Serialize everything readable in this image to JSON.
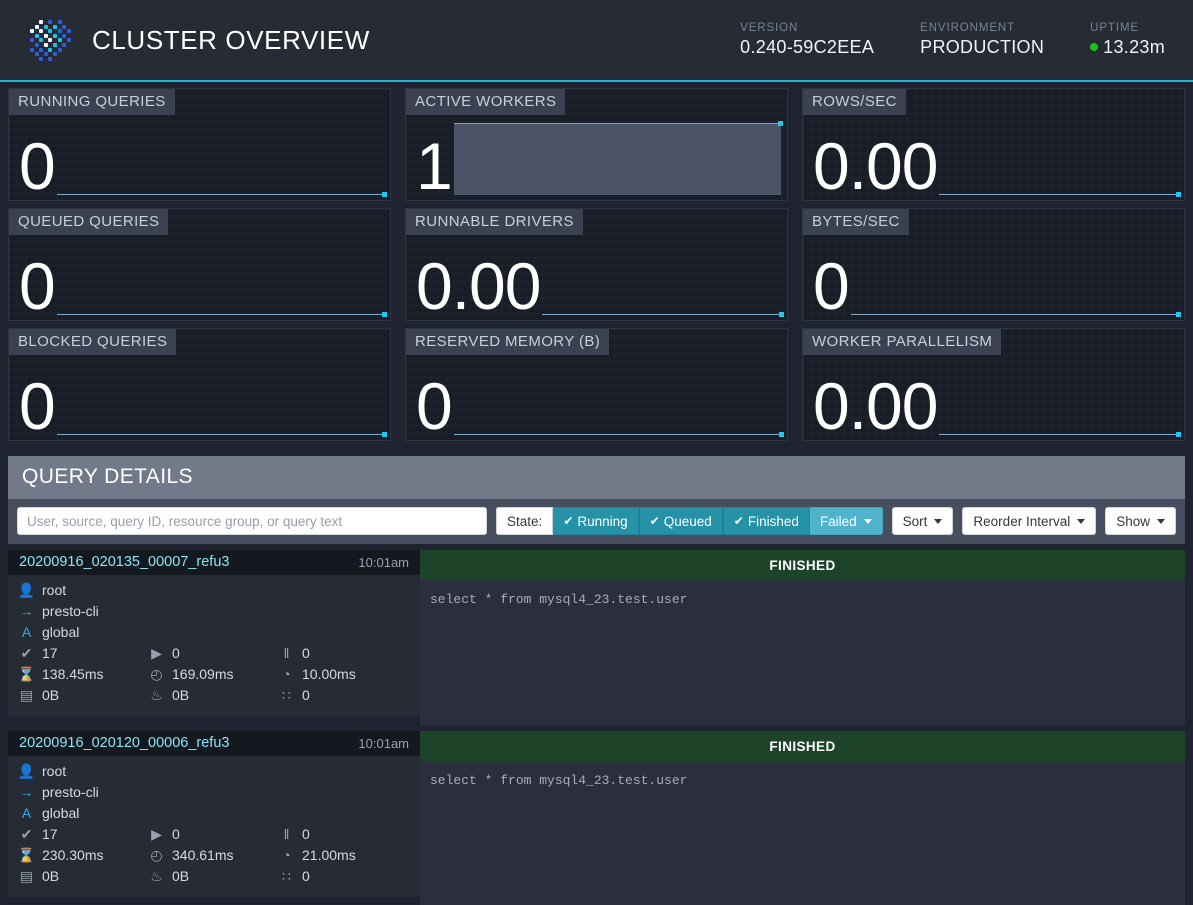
{
  "header": {
    "title": "CLUSTER OVERVIEW",
    "logo_icon": "presto-logo-icon",
    "stats": [
      {
        "key": "VERSION",
        "value": "0.240-59C2EEA",
        "live": false
      },
      {
        "key": "ENVIRONMENT",
        "value": "PRODUCTION",
        "live": false
      },
      {
        "key": "UPTIME",
        "value": "13.23m",
        "live": true
      }
    ],
    "accent_color": "#1fb6d4",
    "live_color": "#19c319"
  },
  "sparklines": {
    "columns": [
      [
        {
          "label": "RUNNING QUERIES",
          "value": "0",
          "fill": false
        },
        {
          "label": "QUEUED QUERIES",
          "value": "0",
          "fill": false
        },
        {
          "label": "BLOCKED QUERIES",
          "value": "0",
          "fill": false
        }
      ],
      [
        {
          "label": "ACTIVE WORKERS",
          "value": "1",
          "fill": true
        },
        {
          "label": "RUNNABLE DRIVERS",
          "value": "0.00",
          "fill": false
        },
        {
          "label": "RESERVED MEMORY (B)",
          "value": "0",
          "fill": false
        }
      ],
      [
        {
          "label": "ROWS/SEC",
          "value": "0.00",
          "fill": false
        },
        {
          "label": "BYTES/SEC",
          "value": "0",
          "fill": false
        },
        {
          "label": "WORKER PARALLELISM",
          "value": "0.00",
          "fill": false
        }
      ]
    ],
    "line_color": "#7fa8c9",
    "tip_color": "#25c7ef",
    "fill_color": "#4c5468"
  },
  "query_details": {
    "title": "QUERY DETAILS",
    "search": {
      "value": "",
      "placeholder": "User, source, query ID, resource group, or query text"
    },
    "state_label": "State:",
    "state_buttons": [
      {
        "label": "Running",
        "checked": true,
        "style": "on"
      },
      {
        "label": "Queued",
        "checked": true,
        "style": "on"
      },
      {
        "label": "Finished",
        "checked": true,
        "style": "on"
      },
      {
        "label": "Failed",
        "checked": false,
        "style": "info"
      }
    ],
    "menus": [
      {
        "label": "Sort"
      },
      {
        "label": "Reorder Interval"
      },
      {
        "label": "Show"
      }
    ],
    "check_glyph": "✔"
  },
  "queries": [
    {
      "id": "20200916_020135_00007_refu3",
      "time": "10:01am",
      "user": "root",
      "source": "presto-cli",
      "resource_group": "global",
      "completed_splits": "17",
      "running_splits": "0",
      "queued_splits": "0",
      "wall_time": "138.45ms",
      "total_cpu_time": "169.09ms",
      "cpu_time": "10.00ms",
      "current_memory": "0B",
      "peak_memory": "0B",
      "cumulative_memory": "0",
      "status": "FINISHED",
      "sql": "select * from mysql4_23.test.user"
    },
    {
      "id": "20200916_020120_00006_refu3",
      "time": "10:01am",
      "user": "root",
      "source": "presto-cli",
      "resource_group": "global",
      "completed_splits": "17",
      "running_splits": "0",
      "queued_splits": "0",
      "wall_time": "230.30ms",
      "total_cpu_time": "340.61ms",
      "cpu_time": "21.00ms",
      "current_memory": "0B",
      "peak_memory": "0B",
      "cumulative_memory": "0",
      "status": "FINISHED",
      "sql": "select * from mysql4_23.test.user"
    }
  ],
  "status_colors": {
    "finished_bar": "#1d4328"
  }
}
